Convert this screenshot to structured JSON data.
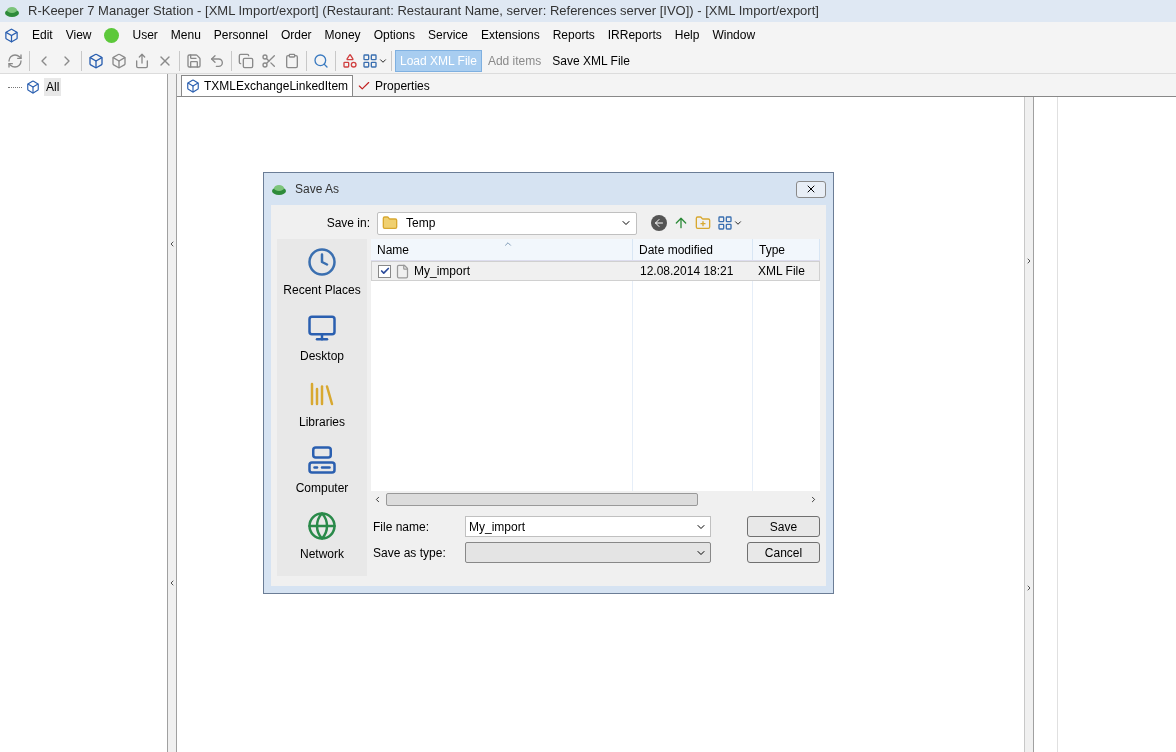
{
  "window": {
    "title": "R-Keeper 7 Manager Station - [XML Import/export] (Restaurant: Restaurant Name, server: References server [IVO]) - [XML Import/export]"
  },
  "menu": [
    {
      "label": "Edit"
    },
    {
      "label": "View"
    },
    {
      "label": "User"
    },
    {
      "label": "Menu"
    },
    {
      "label": "Personnel"
    },
    {
      "label": "Order"
    },
    {
      "label": "Money"
    },
    {
      "label": "Options"
    },
    {
      "label": "Service"
    },
    {
      "label": "Extensions"
    },
    {
      "label": "Reports"
    },
    {
      "label": "IRReports"
    },
    {
      "label": "Help"
    },
    {
      "label": "Window"
    }
  ],
  "toolbar": {
    "buttons": [
      {
        "label": "Load XML File",
        "selected": true,
        "disabled": false
      },
      {
        "label": "Add items",
        "selected": false,
        "disabled": true
      },
      {
        "label": "Save XML File",
        "selected": false,
        "disabled": false
      }
    ]
  },
  "tree": [
    {
      "label": "All",
      "selected": true
    }
  ],
  "tabs": [
    {
      "label": "TXMLExchangeLinkedItem",
      "selected": true
    },
    {
      "label": "Properties",
      "selected": false
    }
  ],
  "dialog": {
    "title": "Save As",
    "save_in_label": "Save in:",
    "save_in_value": "Temp",
    "places": [
      {
        "kind": "recent",
        "label": "Recent Places"
      },
      {
        "kind": "desktop",
        "label": "Desktop"
      },
      {
        "kind": "libraries",
        "label": "Libraries"
      },
      {
        "kind": "computer",
        "label": "Computer"
      },
      {
        "kind": "network",
        "label": "Network"
      }
    ],
    "columns": [
      {
        "label": "Name"
      },
      {
        "label": "Date modified"
      },
      {
        "label": "Type"
      }
    ],
    "files": [
      {
        "name": "My_import",
        "checked": true,
        "date": "12.08.2014 18:21",
        "type": "XML File"
      }
    ],
    "file_name_label": "File name:",
    "file_name_value": "My_import",
    "save_as_type_label": "Save as type:",
    "buttons": [
      "Save",
      "Cancel"
    ]
  }
}
